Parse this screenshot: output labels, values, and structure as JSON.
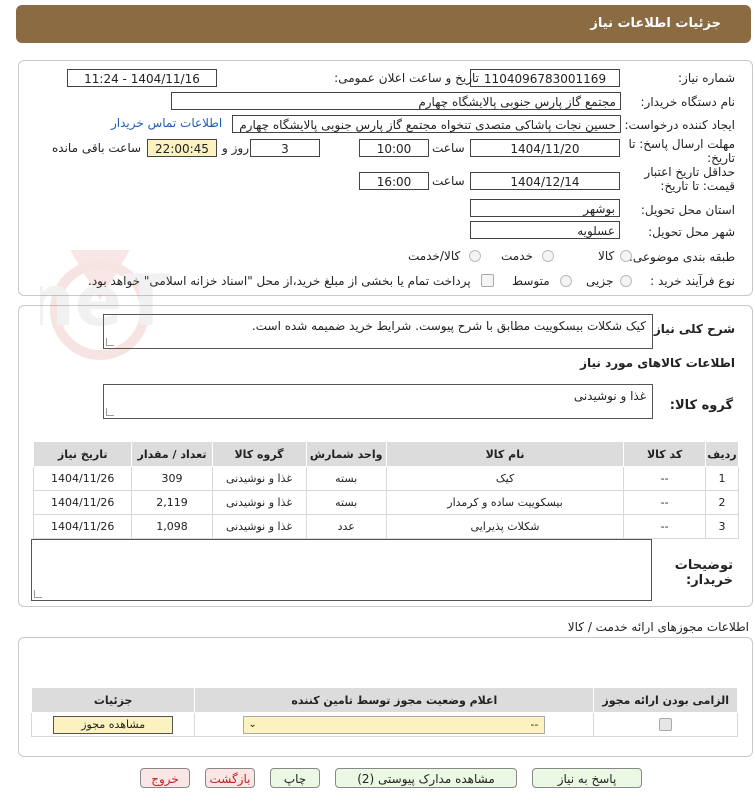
{
  "header": {
    "title": "جزئیات اطلاعات نیاز"
  },
  "fields": {
    "need_number_label": "شماره نیاز:",
    "need_number": "1104096783001169",
    "announce_label": "تاریخ و ساعت اعلان عمومی:",
    "announce_value": "1404/11/16 - 11:24",
    "buyer_org_label": "نام دستگاه خریدار:",
    "buyer_org": "مجتمع گاز پارس جنوبی  پالایشگاه چهارم",
    "creator_label": "ایجاد کننده درخواست:",
    "creator": "حسین نجات پاشاکی متصدی تنخواه مجتمع گاز پارس جنوبی  پالایشگاه چهارم",
    "contact_link": "اطلاعات تماس خریدار",
    "reply_deadline_label": "مهلت ارسال پاسخ: تا تاریخ:",
    "reply_date": "1404/11/20",
    "time_label": "ساعت",
    "reply_time": "10:00",
    "days_value": "3",
    "days_label": "روز و",
    "remaining_value": "22:00:45",
    "remaining_label": "ساعت باقی مانده",
    "validity_label": "حداقل تاریخ اعتبار قیمت: تا تاریخ:",
    "validity_date": "1404/12/14",
    "validity_time": "16:00",
    "province_label": "استان محل تحویل:",
    "province": "بوشهر",
    "city_label": "شهر محل تحویل:",
    "city": "عسلویه",
    "category_label": "طبقه بندی موضوعی:",
    "category_options": [
      "کالا",
      "خدمت",
      "کالا/خدمت"
    ],
    "process_label": "نوع فرآیند خرید :",
    "process_options": [
      "جزیی",
      "متوسط"
    ],
    "payment_note": "پرداخت تمام یا بخشی از مبلغ خرید،از محل \"اسناد خزانه اسلامی\" خواهد بود."
  },
  "description": {
    "label": "شرح کلی نیاز:",
    "text": "کیک شکلات بیسکوییت مطابق با شرح پیوست. شرایط خرید ضمیمه شده است."
  },
  "goods": {
    "section_title": "اطلاعات کالاهای مورد نیاز",
    "group_label": "گروه کالا:",
    "group_value": "غذا و نوشیدنی",
    "columns": [
      "ردیف",
      "کد کالا",
      "نام کالا",
      "واحد شمارش",
      "گروه کالا",
      "تعداد / مقدار",
      "تاریخ نیاز"
    ],
    "rows": [
      [
        "1",
        "--",
        "کیک",
        "بسته",
        "غذا و نوشیدنی",
        "309",
        "1404/11/26"
      ],
      [
        "2",
        "--",
        "بیسکوییت ساده و کرمدار",
        "بسته",
        "غذا و نوشیدنی",
        "2,119",
        "1404/11/26"
      ],
      [
        "3",
        "--",
        "شکلات پذیرایی",
        "عدد",
        "غذا و نوشیدنی",
        "1,098",
        "1404/11/26"
      ]
    ]
  },
  "buyer_notes": {
    "label": "توضیحات خریدار:"
  },
  "permits": {
    "section_title": "اطلاعات مجوزهای ارائه خدمت / کالا",
    "columns": [
      "الزامی بودن ارائه مجوز",
      "اعلام وضعیت مجوز توسط تامین کننده",
      "جزئیات"
    ],
    "select_value": "--",
    "view_button": "مشاهده مجوز"
  },
  "actions": {
    "reply": "پاسخ به نیاز",
    "attachments": "مشاهده مدارک پیوستی (2)",
    "print": "چاپ",
    "back": "بازگشت",
    "exit": "خروج"
  },
  "watermark": "AriaTender.neT",
  "colors": {
    "titlebar": "#8b6b42",
    "highlight": "#fbf2c0",
    "link": "#1f5fb0"
  }
}
